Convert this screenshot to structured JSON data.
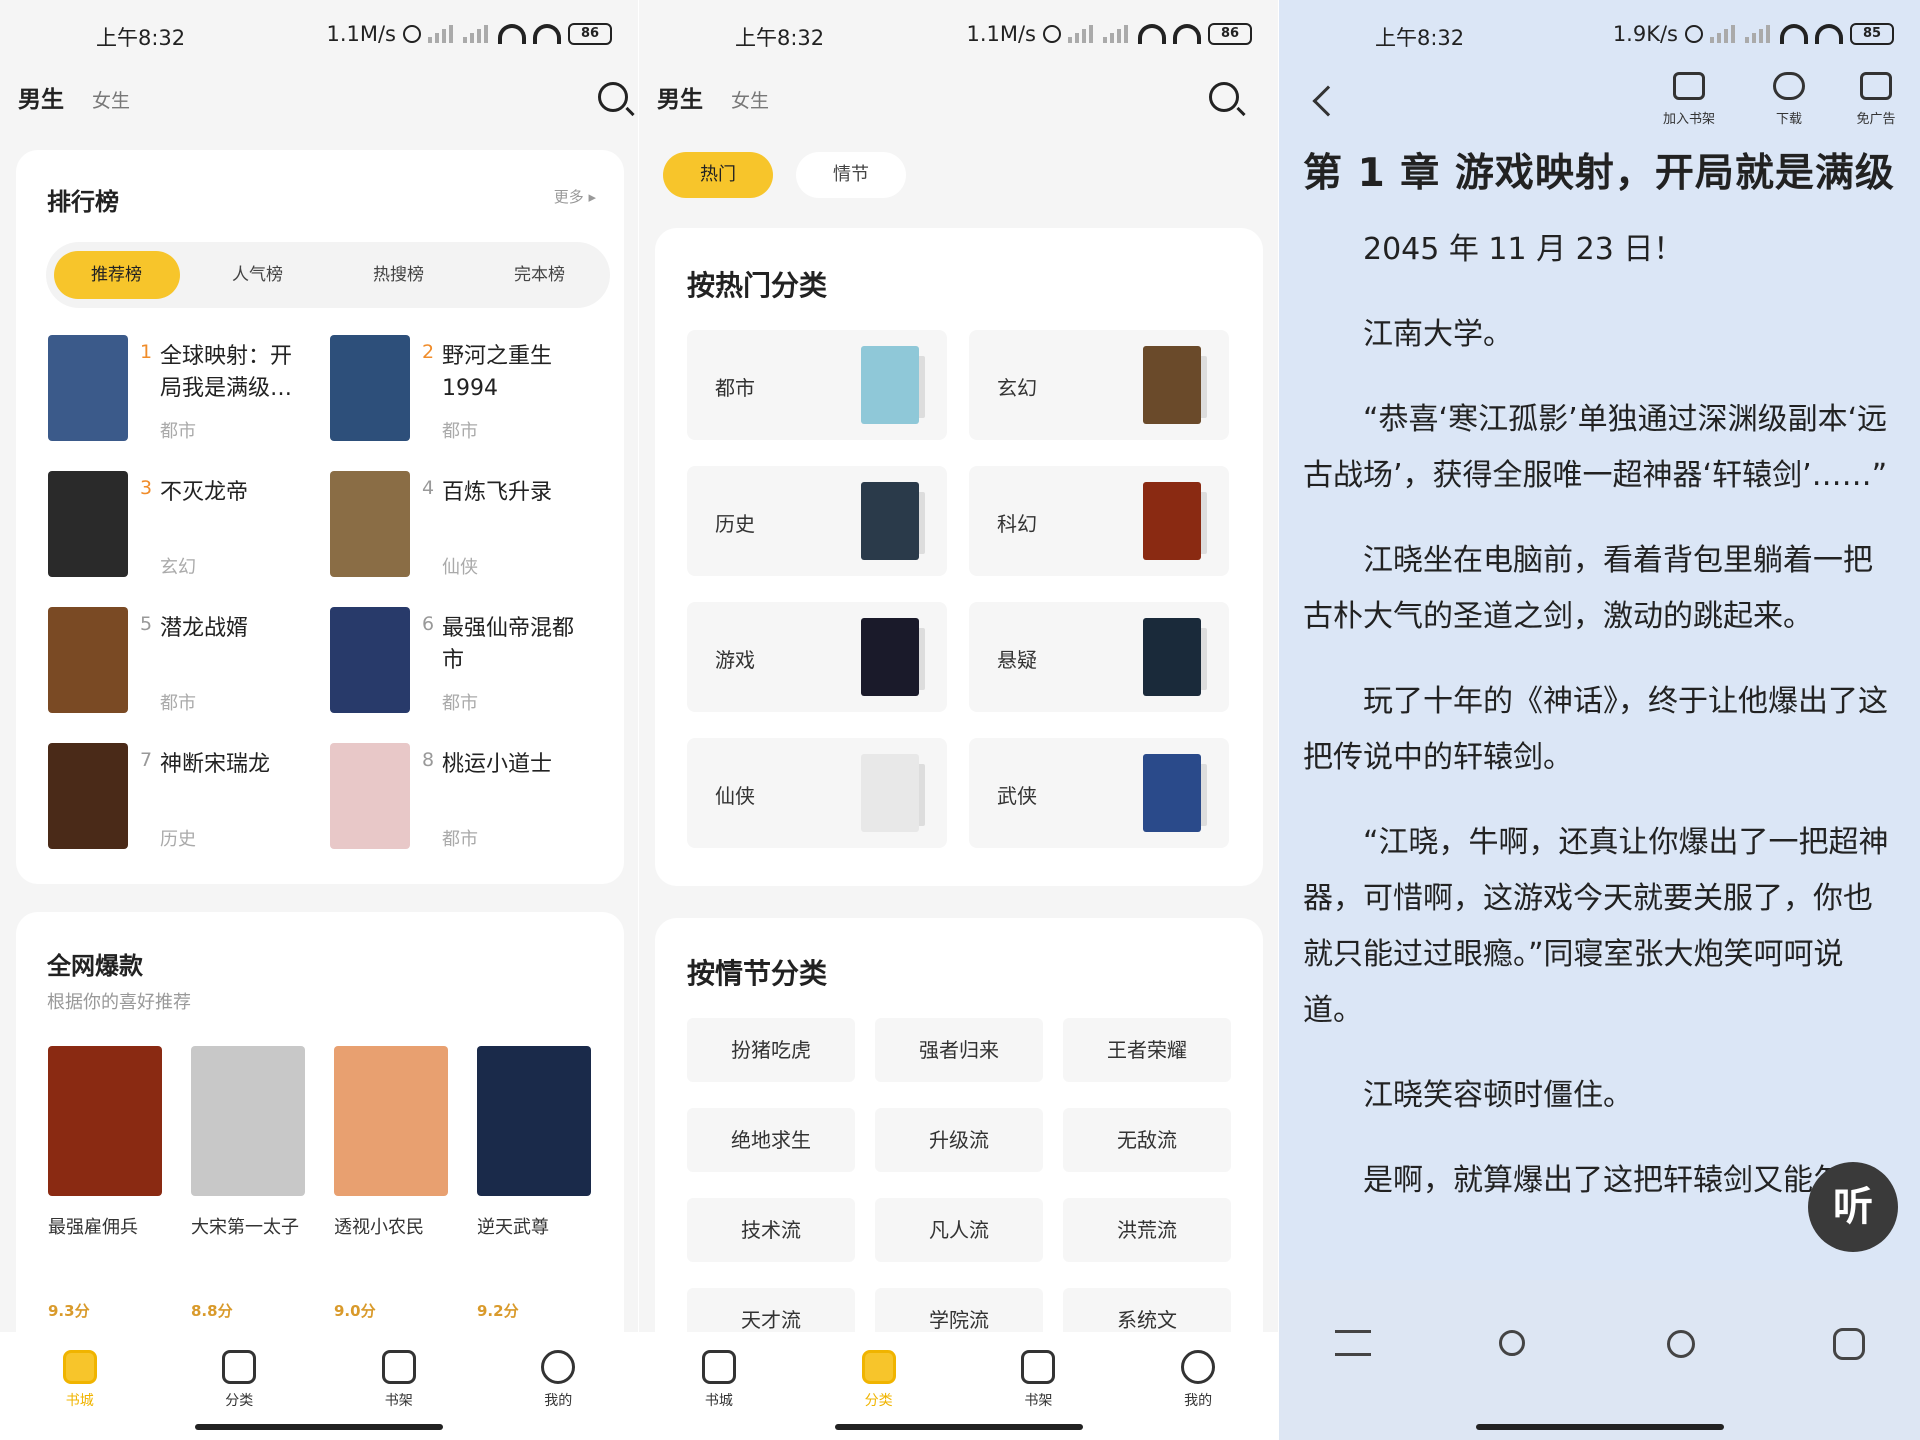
{
  "status": [
    {
      "time": "上午8:32",
      "speed": "1.1M/s",
      "battery": "86"
    },
    {
      "time": "上午8:32",
      "speed": "1.1M/s",
      "battery": "86"
    },
    {
      "time": "上午8:32",
      "speed": "1.9K/s",
      "battery": "85"
    }
  ],
  "gender_tabs": {
    "male": "男生",
    "female": "女生"
  },
  "ranking": {
    "title": "排行榜",
    "more": "更多 ▸",
    "tabs": [
      "推荐榜",
      "人气榜",
      "热搜榜",
      "完本榜"
    ],
    "items": [
      {
        "rank": "1",
        "title": "全球映射：开局我是满级…",
        "tag": "都市",
        "color": "#3b5a8a"
      },
      {
        "rank": "2",
        "title": "野河之重生1994",
        "tag": "都市",
        "color": "#2d4f7a"
      },
      {
        "rank": "3",
        "title": "不灭龙帝",
        "tag": "玄幻",
        "color": "#2a2a2a"
      },
      {
        "rank": "4",
        "title": "百炼飞升录",
        "tag": "仙侠",
        "color": "#8a6d45"
      },
      {
        "rank": "5",
        "title": "潜龙战婿",
        "tag": "都市",
        "color": "#7a4a24"
      },
      {
        "rank": "6",
        "title": "最强仙帝混都市",
        "tag": "都市",
        "color": "#283a6a"
      },
      {
        "rank": "7",
        "title": "神断宋瑞龙",
        "tag": "历史",
        "color": "#4a2a18"
      },
      {
        "rank": "8",
        "title": "桃运小道士",
        "tag": "都市",
        "color": "#e8c8c8"
      }
    ]
  },
  "hot": {
    "title": "全网爆款",
    "subtitle": "根据你的喜好推荐",
    "books": [
      {
        "name": "最强雇佣兵",
        "score": "9.3分",
        "color": "#8a2a12"
      },
      {
        "name": "大宋第一太子",
        "score": "8.8分",
        "color": "#c8c8c8"
      },
      {
        "name": "透视小农民",
        "score": "9.0分",
        "color": "#e8a070"
      },
      {
        "name": "逆天武尊",
        "score": "9.2分",
        "color": "#1a2a4a"
      }
    ]
  },
  "nav": {
    "p1": [
      "书城",
      "分类",
      "书架",
      "我的"
    ],
    "p2": [
      "书城",
      "分类",
      "书架",
      "我的"
    ]
  },
  "category": {
    "pills": [
      "热门",
      "情节"
    ],
    "hot_title": "按热门分类",
    "hot_items": [
      {
        "label": "都市",
        "color": "#8fc8d8"
      },
      {
        "label": "玄幻",
        "color": "#6a4a2a"
      },
      {
        "label": "历史",
        "color": "#2a3a4a"
      },
      {
        "label": "科幻",
        "color": "#8a2a12"
      },
      {
        "label": "游戏",
        "color": "#1a1a2a"
      },
      {
        "label": "悬疑",
        "color": "#1a2a3a"
      },
      {
        "label": "仙侠",
        "color": "#e8e8e8"
      },
      {
        "label": "武侠",
        "color": "#2a4a8a"
      }
    ],
    "plot_title": "按情节分类",
    "plot_items": [
      "扮猪吃虎",
      "强者归来",
      "王者荣耀",
      "绝地求生",
      "升级流",
      "无敌流",
      "技术流",
      "凡人流",
      "洪荒流",
      "天才流",
      "学院流",
      "系统文"
    ]
  },
  "reader": {
    "actions": [
      "加入书架",
      "下载",
      "免广告"
    ],
    "chapter": "第 1 章 游戏映射，开局就是满级",
    "paragraphs": [
      "2045 年 11 月 23 日！",
      "江南大学。",
      "“恭喜‘寒江孤影’单独通过深渊级副本‘远古战场’，获得全服唯一超神器‘轩辕剑’……”",
      "江晓坐在电脑前，看着背包里躺着一把古朴大气的圣道之剑，激动的跳起来。",
      "玩了十年的《神话》，终于让他爆出了这把传说中的轩辕剑。",
      "“江晓，牛啊，还真让你爆出了一把超神器，可惜啊，这游戏今天就要关服了，你也就只能过过眼瘾。”同寝室张大炮笑呵呵说道。",
      "江晓笑容顿时僵住。",
      "是啊，就算爆出了这把轩辕剑又能怎么"
    ],
    "listen": "听"
  }
}
